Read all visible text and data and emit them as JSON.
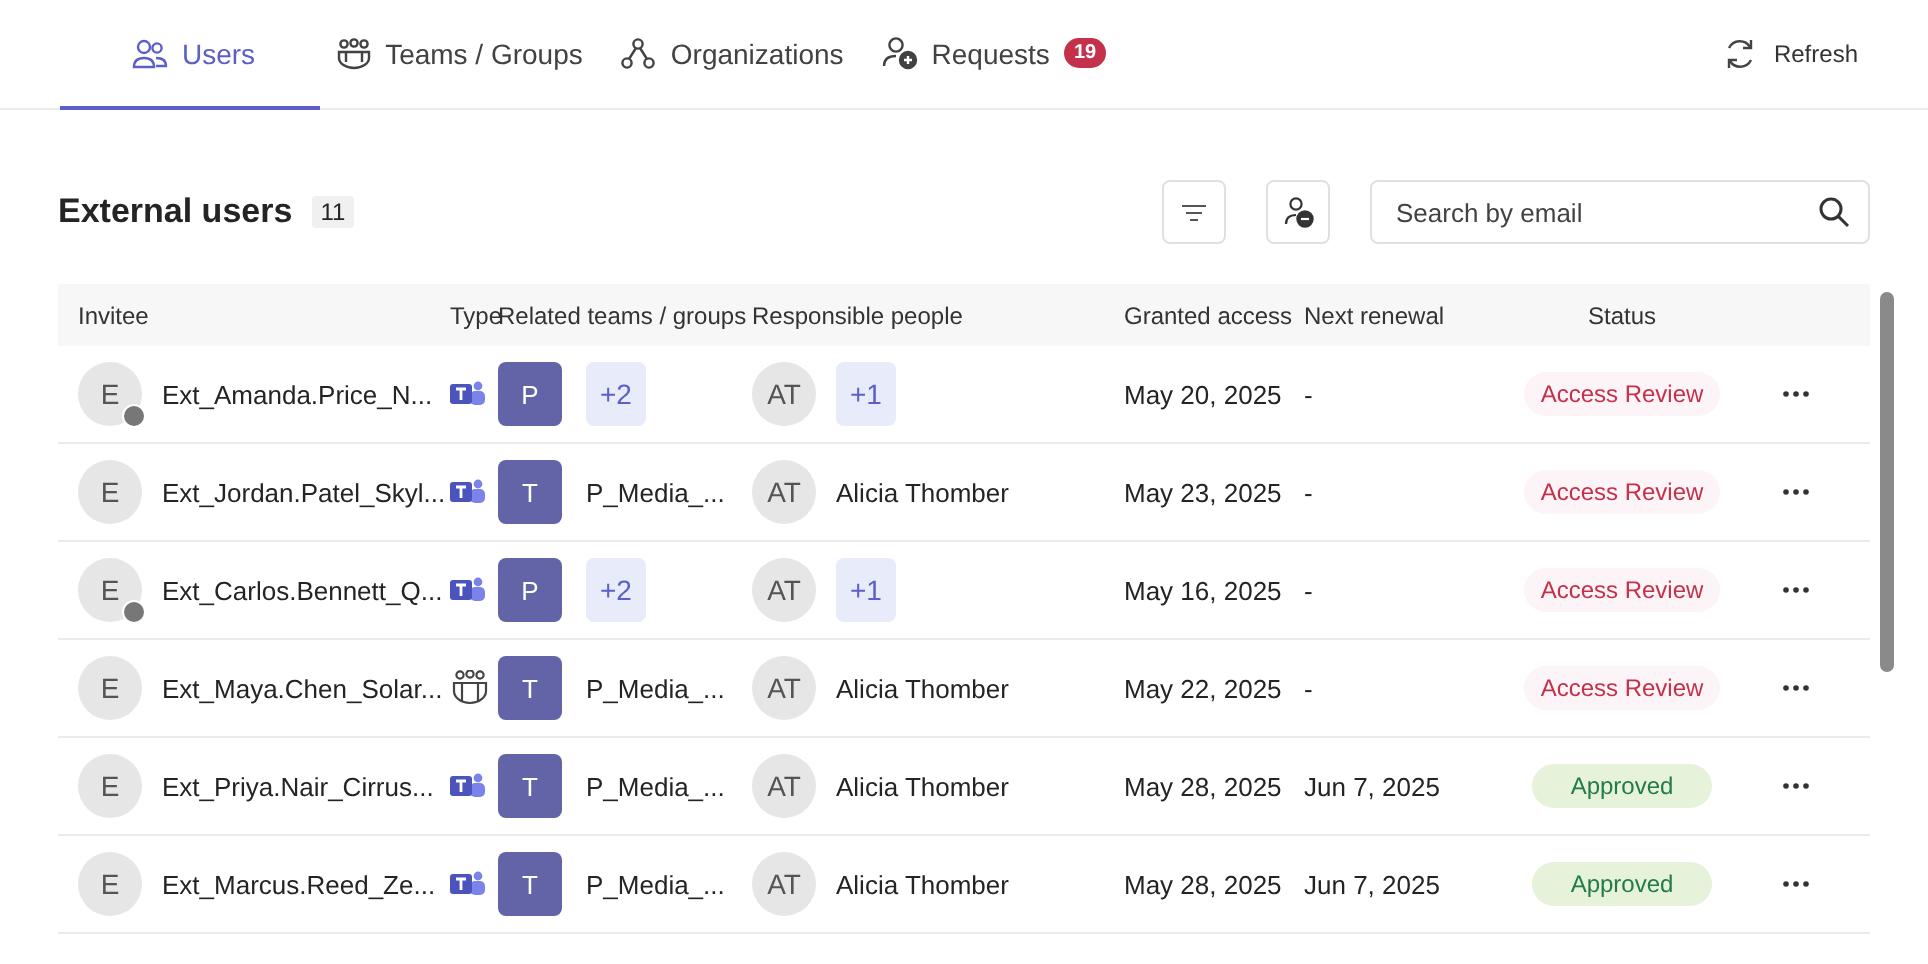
{
  "tabs": [
    {
      "label": "Users",
      "selected": true
    },
    {
      "label": "Teams / Groups",
      "selected": false
    },
    {
      "label": "Organizations",
      "selected": false
    },
    {
      "label": "Requests",
      "badge": "19",
      "selected": false
    }
  ],
  "refresh": {
    "label": "Refresh"
  },
  "heading": {
    "title": "External users",
    "count": "11"
  },
  "search": {
    "placeholder": "Search by email"
  },
  "table": {
    "columns": [
      "Invitee",
      "Type",
      "Related teams / groups",
      "Responsible people",
      "Granted access",
      "Next renewal",
      "Status"
    ],
    "rows": [
      {
        "initial": "E",
        "guest": true,
        "name": "Ext_Amanda.Price_N...",
        "kind": "teams",
        "team_initial": "P",
        "team": {
          "kind": "more",
          "text": "+2"
        },
        "owner_initials": "AT",
        "owner": {
          "kind": "more",
          "text": "+1"
        },
        "granted": "May 20, 2025",
        "renewal": "-",
        "status": {
          "kind": "review",
          "label": "Access Review"
        }
      },
      {
        "initial": "E",
        "guest": false,
        "name": "Ext_Jordan.Patel_Skyl...",
        "kind": "teams",
        "team_initial": "T",
        "team": {
          "kind": "name",
          "text": "P_Media_..."
        },
        "owner_initials": "AT",
        "owner": {
          "kind": "name",
          "text": "Alicia Thomber"
        },
        "granted": "May 23, 2025",
        "renewal": "-",
        "status": {
          "kind": "review",
          "label": "Access Review"
        }
      },
      {
        "initial": "E",
        "guest": true,
        "name": "Ext_Carlos.Bennett_Q...",
        "kind": "teams",
        "team_initial": "P",
        "team": {
          "kind": "more",
          "text": "+2"
        },
        "owner_initials": "AT",
        "owner": {
          "kind": "more",
          "text": "+1"
        },
        "granted": "May 16, 2025",
        "renewal": "-",
        "status": {
          "kind": "review",
          "label": "Access Review"
        }
      },
      {
        "initial": "E",
        "guest": false,
        "name": "Ext_Maya.Chen_Solar...",
        "kind": "group",
        "team_initial": "T",
        "team": {
          "kind": "name",
          "text": "P_Media_..."
        },
        "owner_initials": "AT",
        "owner": {
          "kind": "name",
          "text": "Alicia Thomber"
        },
        "granted": "May 22, 2025",
        "renewal": "-",
        "status": {
          "kind": "review",
          "label": "Access Review"
        }
      },
      {
        "initial": "E",
        "guest": false,
        "name": "Ext_Priya.Nair_Cirrus...",
        "kind": "teams",
        "team_initial": "T",
        "team": {
          "kind": "name",
          "text": "P_Media_..."
        },
        "owner_initials": "AT",
        "owner": {
          "kind": "name",
          "text": "Alicia Thomber"
        },
        "granted": "May 28, 2025",
        "renewal": "Jun 7, 2025",
        "status": {
          "kind": "approved",
          "label": "Approved"
        }
      },
      {
        "initial": "E",
        "guest": false,
        "name": "Ext_Marcus.Reed_Ze...",
        "kind": "teams",
        "team_initial": "T",
        "team": {
          "kind": "name",
          "text": "P_Media_..."
        },
        "owner_initials": "AT",
        "owner": {
          "kind": "name",
          "text": "Alicia Thomber"
        },
        "granted": "May 28, 2025",
        "renewal": "Jun 7, 2025",
        "status": {
          "kind": "approved",
          "label": "Approved"
        }
      }
    ]
  }
}
